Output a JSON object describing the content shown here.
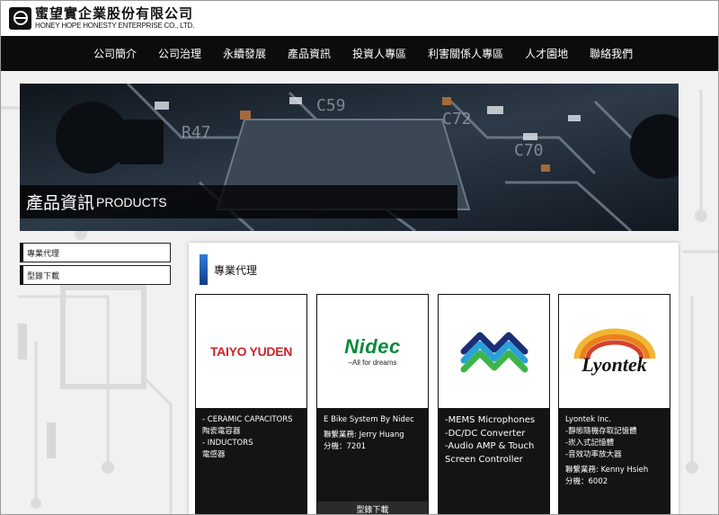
{
  "brand": {
    "name_zh": "蜜望實企業股份有限公司",
    "name_en": "HONEY HOPE HONESTY ENTERPRISE CO., LTD."
  },
  "nav": {
    "items": [
      {
        "label": "公司簡介"
      },
      {
        "label": "公司治理"
      },
      {
        "label": "永續發展"
      },
      {
        "label": "產品資訊"
      },
      {
        "label": "投資人專區"
      },
      {
        "label": "利害關係人專區"
      },
      {
        "label": "人才園地"
      },
      {
        "label": "聯絡我們"
      }
    ]
  },
  "hero": {
    "title_zh": "產品資訊",
    "title_en": "PRODUCTS"
  },
  "sidebar": {
    "items": [
      {
        "label": "專業代理"
      },
      {
        "label": "型錄下載"
      }
    ]
  },
  "section": {
    "title": "專業代理"
  },
  "cards": [
    {
      "logo_text": "TAIYO YUDEN",
      "lines": [
        "- CERAMIC CAPACITORS",
        "陶瓷電容器",
        "- INDUCTORS",
        "電感器"
      ]
    },
    {
      "logo_text": "Nidec",
      "logo_tagline": "–All for dreams",
      "lines": [
        "E Bike System By Nidec",
        "聯繫業務: Jerry Huang",
        "分機：7201"
      ],
      "button": "型錄下載"
    },
    {
      "lines": [
        "-MEMS Microphones",
        "-DC/DC Converter",
        "-Audio AMP & Touch",
        "Screen Controller"
      ]
    },
    {
      "logo_text": "Lyontek",
      "lines": [
        "Lyontek Inc.",
        "-靜態隨機存取記憶體",
        "-崁入式記憶體",
        "-音效功率放大器",
        "聯繫業務: Kenny Hsieh",
        "分機：6002"
      ]
    }
  ],
  "colors": {
    "nav_bg": "#0c0c0c",
    "accent": "#2f7ad8",
    "taiyo_red": "#cc2229",
    "nidec_green": "#0a8a3a",
    "lyontek_orange": "#e8801e"
  }
}
